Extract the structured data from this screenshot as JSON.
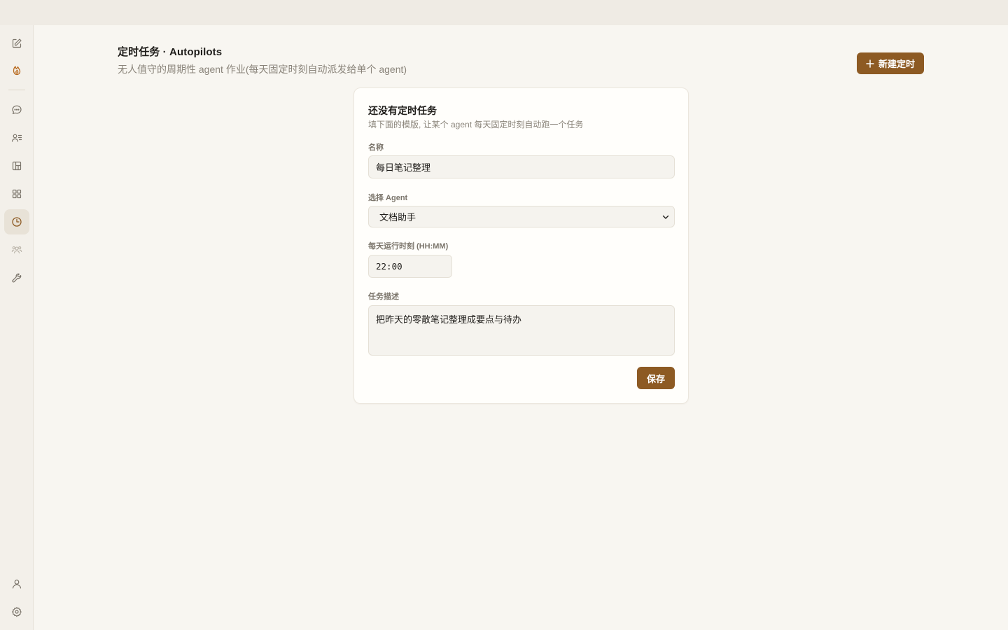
{
  "header": {
    "title": "定时任务 · Autopilots",
    "subtitle": "无人值守的周期性 agent 作业(每天固定时刻自动派发给单个 agent)",
    "new_button_label": "新建定时"
  },
  "sidebar": {
    "items": [
      {
        "icon": "edit-icon"
      },
      {
        "icon": "flame-icon"
      },
      {
        "icon": "chat-bubble-icon"
      },
      {
        "icon": "contacts-icon"
      },
      {
        "icon": "board-icon"
      },
      {
        "icon": "apps-grid-icon"
      },
      {
        "icon": "clock-icon",
        "active": true
      },
      {
        "icon": "team-icon"
      },
      {
        "icon": "wrench-icon"
      }
    ],
    "bottom": [
      {
        "icon": "user-icon"
      },
      {
        "icon": "gear-icon"
      }
    ]
  },
  "form": {
    "title": "还没有定时任务",
    "hint": "填下面的模版, 让某个 agent 每天固定时刻自动跑一个任务",
    "name_label": "名称",
    "name_value": "每日笔记整理",
    "agent_label": "选择 Agent",
    "agent_value": "文档助手",
    "time_label": "每天运行时刻 (HH:MM)",
    "time_value": "22:00",
    "desc_label": "任务描述",
    "desc_value": "把昨天的零散笔记整理成要点与待办",
    "save_label": "保存"
  },
  "colors": {
    "accent": "#8d5a23",
    "background": "#f8f6f1",
    "card": "#fffefb"
  }
}
